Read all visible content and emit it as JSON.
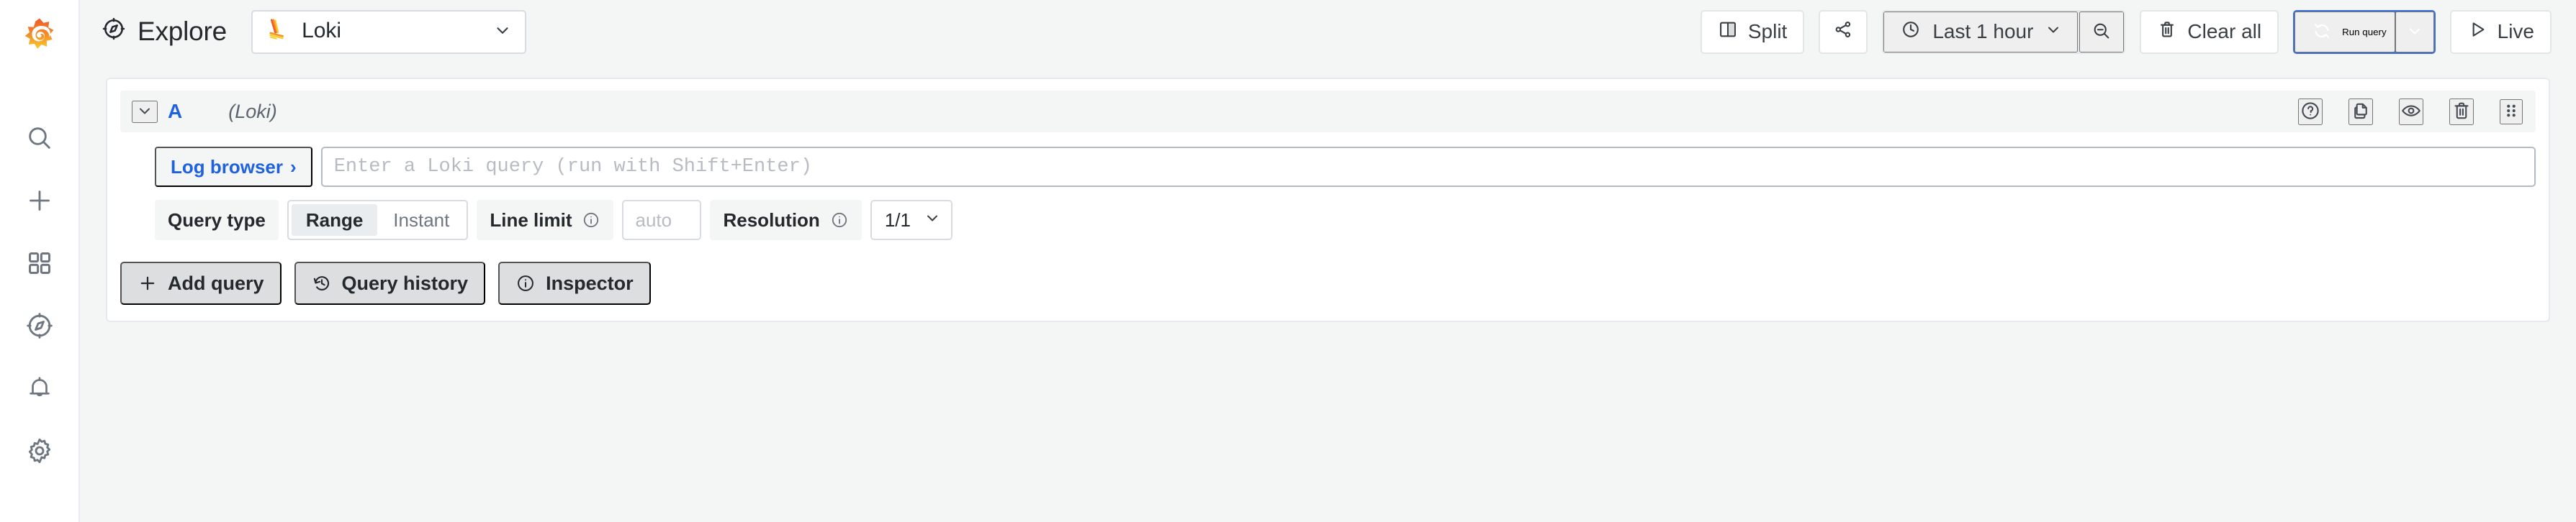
{
  "app": {
    "brand_icon": "grafana-logo",
    "accent_blue": "#3d71d9",
    "link_blue": "#1f62e0",
    "page_background": "#f4f5f5",
    "panel_background": "#ffffff"
  },
  "sidebar": {
    "items": [
      {
        "icon": "search-icon",
        "name": "search"
      },
      {
        "icon": "plus-icon",
        "name": "create"
      },
      {
        "icon": "dashboards-grid-icon",
        "name": "dashboards"
      },
      {
        "icon": "compass-explore-icon",
        "name": "explore"
      },
      {
        "icon": "bell-alerting-icon",
        "name": "alerting"
      },
      {
        "icon": "gear-configuration-icon",
        "name": "configuration"
      }
    ]
  },
  "topbar": {
    "title": "Explore",
    "title_icon": "compass-explore-icon",
    "datasource": {
      "name": "Loki",
      "logo": "loki-logo",
      "caret_icon": "chevron-down-icon"
    },
    "split_button": {
      "label": "Split",
      "icon": "split-panes-icon"
    },
    "share_button": {
      "label": "",
      "icon": "share-nodes-icon"
    },
    "time_picker": {
      "range": "Last 1 hour",
      "clock_icon": "clock-icon",
      "caret_icon": "chevron-down-icon",
      "zoom_out_icon": "zoom-out-icon"
    },
    "clear_all_button": {
      "label": "Clear all",
      "icon": "trash-icon"
    },
    "run_query_button": {
      "label": "Run query",
      "icon": "refresh-sync-icon",
      "caret_icon": "chevron-down-icon"
    },
    "live_button": {
      "label": "Live",
      "icon": "play-icon"
    }
  },
  "query_row": {
    "collapse_icon": "chevron-down-icon",
    "ref_id": "A",
    "datasource_label": "(Loki)",
    "actions": [
      {
        "icon": "help-circle-icon",
        "name": "query-help"
      },
      {
        "icon": "copy-duplicate-icon",
        "name": "duplicate-query"
      },
      {
        "icon": "eye-icon",
        "name": "toggle-query-visibility"
      },
      {
        "icon": "trash-icon",
        "name": "remove-query"
      },
      {
        "icon": "drag-handle-icon",
        "name": "drag-query"
      }
    ]
  },
  "query_editor": {
    "log_browser": {
      "label": "Log browser",
      "chevron": "›"
    },
    "query_input": {
      "value": "",
      "placeholder": "Enter a Loki query (run with Shift+Enter)"
    },
    "options": {
      "query_type": {
        "label": "Query type",
        "choices": [
          {
            "label": "Range",
            "selected": true
          },
          {
            "label": "Instant",
            "selected": false
          }
        ]
      },
      "line_limit": {
        "label": "Line limit",
        "info_icon": "info-circle-icon",
        "value": "",
        "placeholder": "auto"
      },
      "resolution": {
        "label": "Resolution",
        "info_icon": "info-circle-icon",
        "value": "1/1",
        "caret_icon": "chevron-down-icon"
      }
    }
  },
  "query_actions": [
    {
      "label": "Add query",
      "icon": "plus-icon"
    },
    {
      "label": "Query history",
      "icon": "history-icon"
    },
    {
      "label": "Inspector",
      "icon": "info-circle-icon"
    }
  ]
}
